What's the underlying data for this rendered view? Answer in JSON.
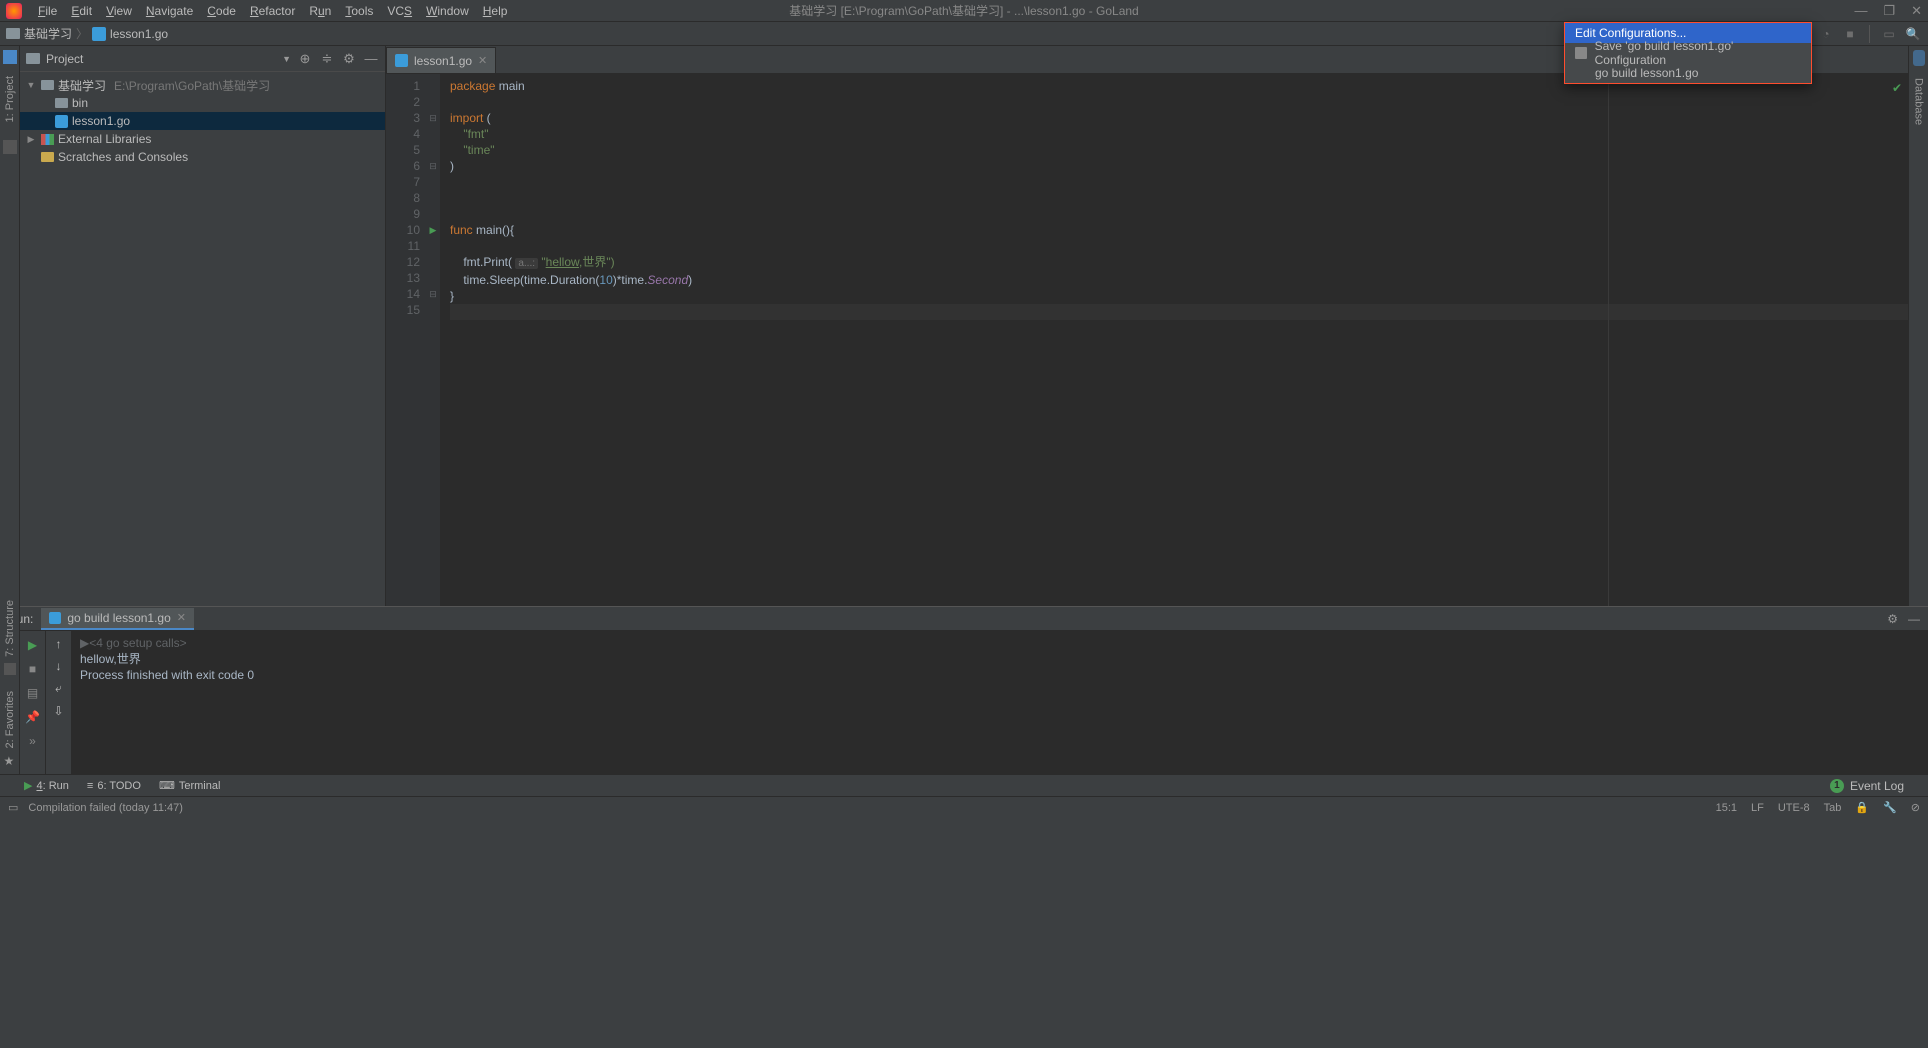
{
  "window": {
    "title": "基础学习 [E:\\Program\\GoPath\\基础学习] - ...\\lesson1.go - GoLand"
  },
  "menu": {
    "file": "File",
    "edit": "Edit",
    "view": "View",
    "navigate": "Navigate",
    "code": "Code",
    "refactor": "Refactor",
    "run": "Run",
    "tools": "Tools",
    "vcs": "VCS",
    "window": "Window",
    "help": "Help"
  },
  "breadcrumb": {
    "project": "基础学习",
    "file": "lesson1.go"
  },
  "run_config": {
    "selected": "go build lesson1.go",
    "popup": {
      "edit": "Edit Configurations...",
      "save": "Save 'go build lesson1.go' Configuration",
      "item1": "go build lesson1.go"
    }
  },
  "project_tool": {
    "title": "Project",
    "root": "基础学习",
    "root_path": "E:\\Program\\GoPath\\基础学习",
    "bin": "bin",
    "file1": "lesson1.go",
    "ext_libs": "External Libraries",
    "scratches": "Scratches and Consoles"
  },
  "side_tabs": {
    "project": "1: Project",
    "structure": "7: Structure",
    "favorites": "2: Favorites",
    "database": "Database"
  },
  "editor": {
    "tab": "lesson1.go",
    "lines": {
      "l1": "package",
      "l1b": " main",
      "l3": "import",
      "l3b": " (",
      "l4": "    \"fmt\"",
      "l5": "    \"time\"",
      "l6": ")",
      "l10": "func",
      "l10b": " main(){",
      "l12pre": "    fmt.Print( ",
      "l12hint": "a...:",
      "l12str1": "\"",
      "l12url": "hellow",
      "l12str2": ",世界\")",
      "l13a": "    time.Sleep(time.Duration(",
      "l13num": "10",
      "l13b": ")*time.",
      "l13c": "Second",
      "l13d": ")",
      "l14": "}"
    }
  },
  "run_tool": {
    "label": "Run:",
    "tab": "go build lesson1.go",
    "out1": "<4 go setup calls>",
    "out2": "hellow,世界",
    "out3": "Process finished with exit code 0"
  },
  "bottom": {
    "run": "4: Run",
    "todo": "6: TODO",
    "terminal": "Terminal",
    "event_log": "Event Log",
    "event_count": "1"
  },
  "status": {
    "msg": "Compilation failed (today 11:47)",
    "pos": "15:1",
    "le": "LF",
    "enc": "UTE-8",
    "indent": "Tab"
  }
}
